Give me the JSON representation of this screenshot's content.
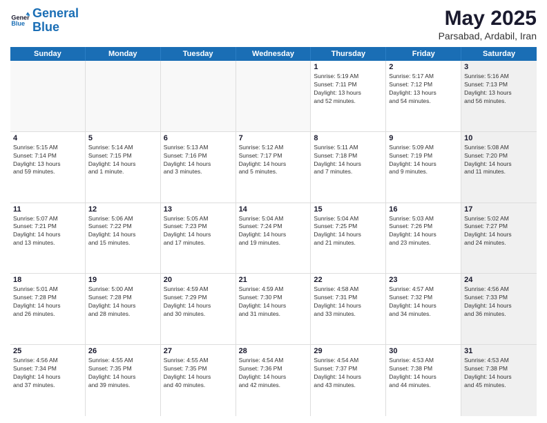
{
  "logo": {
    "line1": "General",
    "line2": "Blue"
  },
  "title": "May 2025",
  "subtitle": "Parsabad, Ardabil, Iran",
  "header": {
    "days": [
      "Sunday",
      "Monday",
      "Tuesday",
      "Wednesday",
      "Thursday",
      "Friday",
      "Saturday"
    ]
  },
  "weeks": [
    [
      {
        "day": "",
        "empty": true
      },
      {
        "day": "",
        "empty": true
      },
      {
        "day": "",
        "empty": true
      },
      {
        "day": "",
        "empty": true
      },
      {
        "day": "1",
        "line1": "Sunrise: 5:19 AM",
        "line2": "Sunset: 7:11 PM",
        "line3": "Daylight: 13 hours",
        "line4": "and 52 minutes."
      },
      {
        "day": "2",
        "line1": "Sunrise: 5:17 AM",
        "line2": "Sunset: 7:12 PM",
        "line3": "Daylight: 13 hours",
        "line4": "and 54 minutes."
      },
      {
        "day": "3",
        "line1": "Sunrise: 5:16 AM",
        "line2": "Sunset: 7:13 PM",
        "line3": "Daylight: 13 hours",
        "line4": "and 56 minutes.",
        "shaded": true
      }
    ],
    [
      {
        "day": "4",
        "line1": "Sunrise: 5:15 AM",
        "line2": "Sunset: 7:14 PM",
        "line3": "Daylight: 13 hours",
        "line4": "and 59 minutes."
      },
      {
        "day": "5",
        "line1": "Sunrise: 5:14 AM",
        "line2": "Sunset: 7:15 PM",
        "line3": "Daylight: 14 hours",
        "line4": "and 1 minute."
      },
      {
        "day": "6",
        "line1": "Sunrise: 5:13 AM",
        "line2": "Sunset: 7:16 PM",
        "line3": "Daylight: 14 hours",
        "line4": "and 3 minutes."
      },
      {
        "day": "7",
        "line1": "Sunrise: 5:12 AM",
        "line2": "Sunset: 7:17 PM",
        "line3": "Daylight: 14 hours",
        "line4": "and 5 minutes."
      },
      {
        "day": "8",
        "line1": "Sunrise: 5:11 AM",
        "line2": "Sunset: 7:18 PM",
        "line3": "Daylight: 14 hours",
        "line4": "and 7 minutes."
      },
      {
        "day": "9",
        "line1": "Sunrise: 5:09 AM",
        "line2": "Sunset: 7:19 PM",
        "line3": "Daylight: 14 hours",
        "line4": "and 9 minutes."
      },
      {
        "day": "10",
        "line1": "Sunrise: 5:08 AM",
        "line2": "Sunset: 7:20 PM",
        "line3": "Daylight: 14 hours",
        "line4": "and 11 minutes.",
        "shaded": true
      }
    ],
    [
      {
        "day": "11",
        "line1": "Sunrise: 5:07 AM",
        "line2": "Sunset: 7:21 PM",
        "line3": "Daylight: 14 hours",
        "line4": "and 13 minutes."
      },
      {
        "day": "12",
        "line1": "Sunrise: 5:06 AM",
        "line2": "Sunset: 7:22 PM",
        "line3": "Daylight: 14 hours",
        "line4": "and 15 minutes."
      },
      {
        "day": "13",
        "line1": "Sunrise: 5:05 AM",
        "line2": "Sunset: 7:23 PM",
        "line3": "Daylight: 14 hours",
        "line4": "and 17 minutes."
      },
      {
        "day": "14",
        "line1": "Sunrise: 5:04 AM",
        "line2": "Sunset: 7:24 PM",
        "line3": "Daylight: 14 hours",
        "line4": "and 19 minutes."
      },
      {
        "day": "15",
        "line1": "Sunrise: 5:04 AM",
        "line2": "Sunset: 7:25 PM",
        "line3": "Daylight: 14 hours",
        "line4": "and 21 minutes."
      },
      {
        "day": "16",
        "line1": "Sunrise: 5:03 AM",
        "line2": "Sunset: 7:26 PM",
        "line3": "Daylight: 14 hours",
        "line4": "and 23 minutes."
      },
      {
        "day": "17",
        "line1": "Sunrise: 5:02 AM",
        "line2": "Sunset: 7:27 PM",
        "line3": "Daylight: 14 hours",
        "line4": "and 24 minutes.",
        "shaded": true
      }
    ],
    [
      {
        "day": "18",
        "line1": "Sunrise: 5:01 AM",
        "line2": "Sunset: 7:28 PM",
        "line3": "Daylight: 14 hours",
        "line4": "and 26 minutes."
      },
      {
        "day": "19",
        "line1": "Sunrise: 5:00 AM",
        "line2": "Sunset: 7:28 PM",
        "line3": "Daylight: 14 hours",
        "line4": "and 28 minutes."
      },
      {
        "day": "20",
        "line1": "Sunrise: 4:59 AM",
        "line2": "Sunset: 7:29 PM",
        "line3": "Daylight: 14 hours",
        "line4": "and 30 minutes."
      },
      {
        "day": "21",
        "line1": "Sunrise: 4:59 AM",
        "line2": "Sunset: 7:30 PM",
        "line3": "Daylight: 14 hours",
        "line4": "and 31 minutes."
      },
      {
        "day": "22",
        "line1": "Sunrise: 4:58 AM",
        "line2": "Sunset: 7:31 PM",
        "line3": "Daylight: 14 hours",
        "line4": "and 33 minutes."
      },
      {
        "day": "23",
        "line1": "Sunrise: 4:57 AM",
        "line2": "Sunset: 7:32 PM",
        "line3": "Daylight: 14 hours",
        "line4": "and 34 minutes."
      },
      {
        "day": "24",
        "line1": "Sunrise: 4:56 AM",
        "line2": "Sunset: 7:33 PM",
        "line3": "Daylight: 14 hours",
        "line4": "and 36 minutes.",
        "shaded": true
      }
    ],
    [
      {
        "day": "25",
        "line1": "Sunrise: 4:56 AM",
        "line2": "Sunset: 7:34 PM",
        "line3": "Daylight: 14 hours",
        "line4": "and 37 minutes."
      },
      {
        "day": "26",
        "line1": "Sunrise: 4:55 AM",
        "line2": "Sunset: 7:35 PM",
        "line3": "Daylight: 14 hours",
        "line4": "and 39 minutes."
      },
      {
        "day": "27",
        "line1": "Sunrise: 4:55 AM",
        "line2": "Sunset: 7:35 PM",
        "line3": "Daylight: 14 hours",
        "line4": "and 40 minutes."
      },
      {
        "day": "28",
        "line1": "Sunrise: 4:54 AM",
        "line2": "Sunset: 7:36 PM",
        "line3": "Daylight: 14 hours",
        "line4": "and 42 minutes."
      },
      {
        "day": "29",
        "line1": "Sunrise: 4:54 AM",
        "line2": "Sunset: 7:37 PM",
        "line3": "Daylight: 14 hours",
        "line4": "and 43 minutes."
      },
      {
        "day": "30",
        "line1": "Sunrise: 4:53 AM",
        "line2": "Sunset: 7:38 PM",
        "line3": "Daylight: 14 hours",
        "line4": "and 44 minutes."
      },
      {
        "day": "31",
        "line1": "Sunrise: 4:53 AM",
        "line2": "Sunset: 7:38 PM",
        "line3": "Daylight: 14 hours",
        "line4": "and 45 minutes.",
        "shaded": true
      }
    ]
  ]
}
